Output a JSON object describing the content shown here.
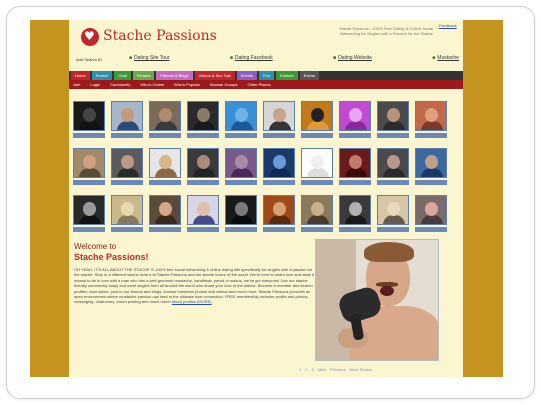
{
  "header": {
    "logo_text": "Stache Passions",
    "tagline": "Stache Passions - 100% Free Dating & Online Social Networking for Singles with a Passion for the Stache",
    "top_link": "Feedback",
    "search_label": "Add Search ID",
    "links": [
      {
        "label": "Dating Site Tour"
      },
      {
        "label": "Dating Facebook"
      },
      {
        "label": "Dating Website"
      },
      {
        "label": "Mustache"
      }
    ]
  },
  "nav": {
    "tabs": [
      {
        "label": "Home",
        "color": "#c0272d"
      },
      {
        "label": "Search",
        "color": "#2e8fa8"
      },
      {
        "label": "Chat",
        "color": "#3a9a3a"
      },
      {
        "label": "Forums",
        "color": "#6aa84f"
      },
      {
        "label": "Friends & Blogs",
        "color": "#c26bc2"
      },
      {
        "label": "Videos & Sex Talk",
        "color": "#c0272d"
      },
      {
        "label": "Events",
        "color": "#8a5fbf"
      },
      {
        "label": "Fun",
        "color": "#2e8fa8"
      },
      {
        "label": "Contact",
        "color": "#3a9a3a"
      },
      {
        "label": "Extras",
        "color": "#555555"
      }
    ],
    "subnav": [
      "Join",
      "Login",
      "Community",
      "Who's Online",
      "Who's Popular",
      "Browse Groups",
      "Other Places"
    ]
  },
  "members": [
    {
      "bg": "#1a1a1a",
      "skin": "#444444",
      "shirt": "#111111"
    },
    {
      "bg": "#a7b7c9",
      "skin": "#c59a7c",
      "shirt": "#2b4a7a"
    },
    {
      "bg": "#7a6a5a",
      "skin": "#b08a6e",
      "shirt": "#3a3a3a"
    },
    {
      "bg": "#2a2a2a",
      "skin": "#8a7a6a",
      "shirt": "#1a1a1a"
    },
    {
      "bg": "#3a8fd6",
      "skin": "#6fb3e6",
      "shirt": "#1a5a9a"
    },
    {
      "bg": "#d6d6d6",
      "skin": "#c9a58a",
      "shirt": "#333333"
    },
    {
      "bg": "#c07a1a",
      "skin": "#222222",
      "shirt": "#e09a3a"
    },
    {
      "bg": "#c04ad0",
      "skin": "#e9a6f0",
      "shirt": "#8a2a9a"
    },
    {
      "bg": "#4a4a4a",
      "skin": "#b8927a",
      "shirt": "#2a2a2a"
    },
    {
      "bg": "#c06a4a",
      "skin": "#e0a080",
      "shirt": "#7a3a2a"
    },
    {
      "bg": "#a08a6a",
      "skin": "#d0a080",
      "shirt": "#5a4a3a"
    },
    {
      "bg": "#5a5a5a",
      "skin": "#b89a88",
      "shirt": "#2a2a2a"
    },
    {
      "bg": "#e6e6e6",
      "skin": "#d9b58a",
      "shirt": "#8a6a4a"
    },
    {
      "bg": "#3a3a3a",
      "skin": "#a88a7a",
      "shirt": "#222222"
    },
    {
      "bg": "#7a5a8a",
      "skin": "#a88aa8",
      "shirt": "#4a2a5a"
    },
    {
      "bg": "#1a3a6a",
      "skin": "#6a9ad6",
      "shirt": "#0a2a5a"
    },
    {
      "bg": "#ffffff",
      "skin": "#f0f0f0",
      "shirt": "#dddddd"
    },
    {
      "bg": "#6a1a1a",
      "skin": "#c07a6a",
      "shirt": "#3a0a0a"
    },
    {
      "bg": "#4a4a4a",
      "skin": "#b8988a",
      "shirt": "#2a2a2a"
    },
    {
      "bg": "#3a6aa0",
      "skin": "#c0a08a",
      "shirt": "#1a3a6a"
    },
    {
      "bg": "#2a2a2a",
      "skin": "#9a9a9a",
      "shirt": "#111111"
    },
    {
      "bg": "#c9b88a",
      "skin": "#e8d8b0",
      "shirt": "#8a7a5a"
    },
    {
      "bg": "#5a4a3a",
      "skin": "#d0a888",
      "shirt": "#3a2a1a"
    },
    {
      "bg": "#d6d6e6",
      "skin": "#e0c0a8",
      "shirt": "#4a4a8a"
    },
    {
      "bg": "#1a1a1a",
      "skin": "#7a7a7a",
      "shirt": "#0a0a0a"
    },
    {
      "bg": "#a04a1a",
      "skin": "#d8a070",
      "shirt": "#5a2a0a"
    },
    {
      "bg": "#8a7a5a",
      "skin": "#c8b08a",
      "shirt": "#4a3a2a"
    },
    {
      "bg": "#3a3a3a",
      "skin": "#b0b0b0",
      "shirt": "#1a1a1a"
    },
    {
      "bg": "#d6c6a6",
      "skin": "#e8d8c0",
      "shirt": "#6a5a4a"
    },
    {
      "bg": "#7a6a6a",
      "skin": "#d8a8a0",
      "shirt": "#4a3a3a"
    }
  ],
  "welcome": {
    "small": "Welcome to",
    "big": "Stache Passions!",
    "body": "OH YEAH, IT'S ALL ABOUT THE STACHE !!! 100% free social networking & online dating site specifically for singles with a passion for the stache. Stop in a different stache lover's at Stache Passions and the stache lovers of the world. We're here to share love and what it means to be in love with a man who has a well groomed mustache, handlebar, pencil or walrus, we've got everyone! Join our stache friendly community today and meet singles from all around the world who share your love of the stache. Become a member and search profiles, chat online, post in our forums and blogs, browse members photos and videos and much more. Stache Passions provides an open environment where mustache passion can lead to the ultimate love connection. FREE membership includes profile and photos, messaging, chatrooms, forum posting and much more!",
    "more_link": "about profiles (MORE)"
  },
  "pager": [
    "1",
    "2",
    "3",
    "Next",
    "Previous",
    "More Photos"
  ]
}
